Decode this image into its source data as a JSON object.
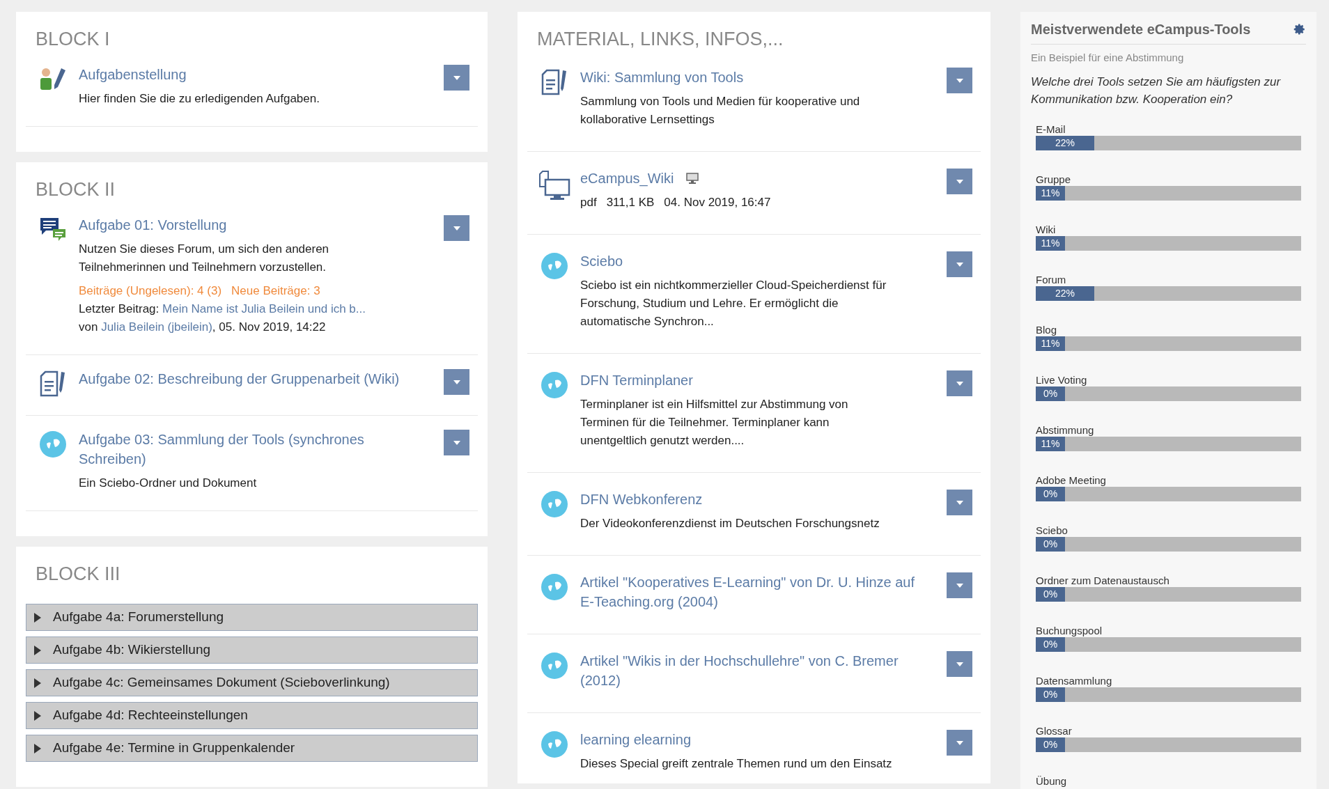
{
  "left_blocks": [
    {
      "title": "BLOCK I",
      "modules": [
        {
          "kind": "task",
          "title": "Aufgabenstellung",
          "description": [
            "Hier finden Sie die zu erledigenden Aufgaben."
          ]
        }
      ]
    },
    {
      "title": "BLOCK II",
      "modules": [
        {
          "kind": "forum",
          "title": "Aufgabe 01: Vorstellung",
          "description": [
            "Nutzen Sie dieses Forum, um sich den anderen Teilnehmerinnen und Teilnehmern vorzustellen."
          ],
          "forum": {
            "posts": "Beiträge (Ungelesen): 4 (3)",
            "new_posts": "Neue Beiträge: 3",
            "last_label": "Letzter Beitrag:",
            "last_link": "Mein Name ist Julia Beilein und ich b...",
            "by_prefix": "von",
            "by_link": "Julia Beilein (jbeilein)",
            "by_suffix": ", 05. Nov 2019, 14:22"
          }
        },
        {
          "kind": "wiki",
          "title": "Aufgabe 02: Beschreibung der Gruppenarbeit (Wiki)"
        },
        {
          "kind": "weblink",
          "title": "Aufgabe 03: Sammlung der Tools (synchrones Schreiben)",
          "description": [
            "Ein Sciebo-Ordner und Dokument"
          ]
        }
      ]
    },
    {
      "title": "BLOCK III",
      "sections": [
        {
          "title": "Aufgabe 4a: Forumerstellung",
          "expanded": false
        },
        {
          "title": "Aufgabe 4b: Wikierstellung",
          "expanded": false
        },
        {
          "title": "Aufgabe 4c: Gemeinsames Dokument (Scieboverlinkung)",
          "expanded": false
        },
        {
          "title": "Aufgabe 4d: Rechteeinstellungen",
          "expanded": false
        },
        {
          "title": "Aufgabe 4e: Termine in Gruppenkalender",
          "expanded": false
        }
      ]
    }
  ],
  "materials": {
    "title": "MATERIAL, LINKS, INFOS,...",
    "modules": [
      {
        "kind": "wiki",
        "title": "Wiki: Sammlung von Tools",
        "description": [
          "Sammlung von Tools und Medien für kooperative und kollaborative Lernsettings"
        ]
      },
      {
        "kind": "file",
        "title": "eCampus_Wiki",
        "file_meta": [
          "pdf",
          "311,1 KB",
          "04. Nov 2019, 16:47"
        ]
      },
      {
        "kind": "weblink",
        "title": "Sciebo",
        "description": [
          "Sciebo ist ein nichtkommerzieller Cloud-Speicherdienst für Forschung, Studium und Lehre. Er ermöglicht die automatische Synchron..."
        ]
      },
      {
        "kind": "weblink",
        "title": "DFN Terminplaner",
        "description": [
          "Terminplaner ist ein Hilfsmittel zur Abstimmung von Terminen für die Teilnehmer. Terminplaner kann unentgeltlich genutzt werden...."
        ]
      },
      {
        "kind": "weblink",
        "title": "DFN Webkonferenz",
        "description": [
          "Der Videokonferenzdienst im Deutschen Forschungsnetz"
        ]
      },
      {
        "kind": "weblink",
        "title": "Artikel \"Kooperatives E-Learning\" von Dr. U. Hinze auf E-Teaching.org (2004)"
      },
      {
        "kind": "weblink",
        "title": "Artikel \"Wikis in der Hochschullehre\" von C. Bremer (2012)"
      },
      {
        "kind": "weblink",
        "title": "learning elearning",
        "description": [
          "Dieses Special greift zentrale Themen rund um den Einsatz"
        ]
      }
    ]
  },
  "poll": {
    "title": "Meistverwendete eCampus-Tools",
    "subtitle": "Ein Beispiel für eine Abstimmung",
    "question": "Welche drei Tools setzen Sie am häufigsten zur Kommunikation bzw. Kooperation ein?",
    "options": [
      {
        "label": "E-Mail",
        "level": 0.22,
        "reading": "22%"
      },
      {
        "label": "Gruppe",
        "level": 0.11,
        "reading": "11%"
      },
      {
        "label": "Wiki",
        "level": 0.11,
        "reading": "11%"
      },
      {
        "label": "Forum",
        "level": 0.22,
        "reading": "22%"
      },
      {
        "label": "Blog",
        "level": 0.11,
        "reading": "11%"
      },
      {
        "label": "Live Voting",
        "reading": "0%"
      },
      {
        "label": "Abstimmung",
        "level": 0.11,
        "reading": "11%"
      },
      {
        "label": "Adobe Meeting",
        "reading": "0%"
      },
      {
        "label": "Sciebo",
        "reading": "0%"
      },
      {
        "label": "Ordner zum Datenaustausch",
        "reading": "0%"
      },
      {
        "label": "Buchungspool",
        "reading": "0%"
      },
      {
        "label": "Datensammlung",
        "reading": "0%"
      },
      {
        "label": "Glossar",
        "reading": "0%"
      },
      {
        "label": "Übung"
      }
    ]
  }
}
